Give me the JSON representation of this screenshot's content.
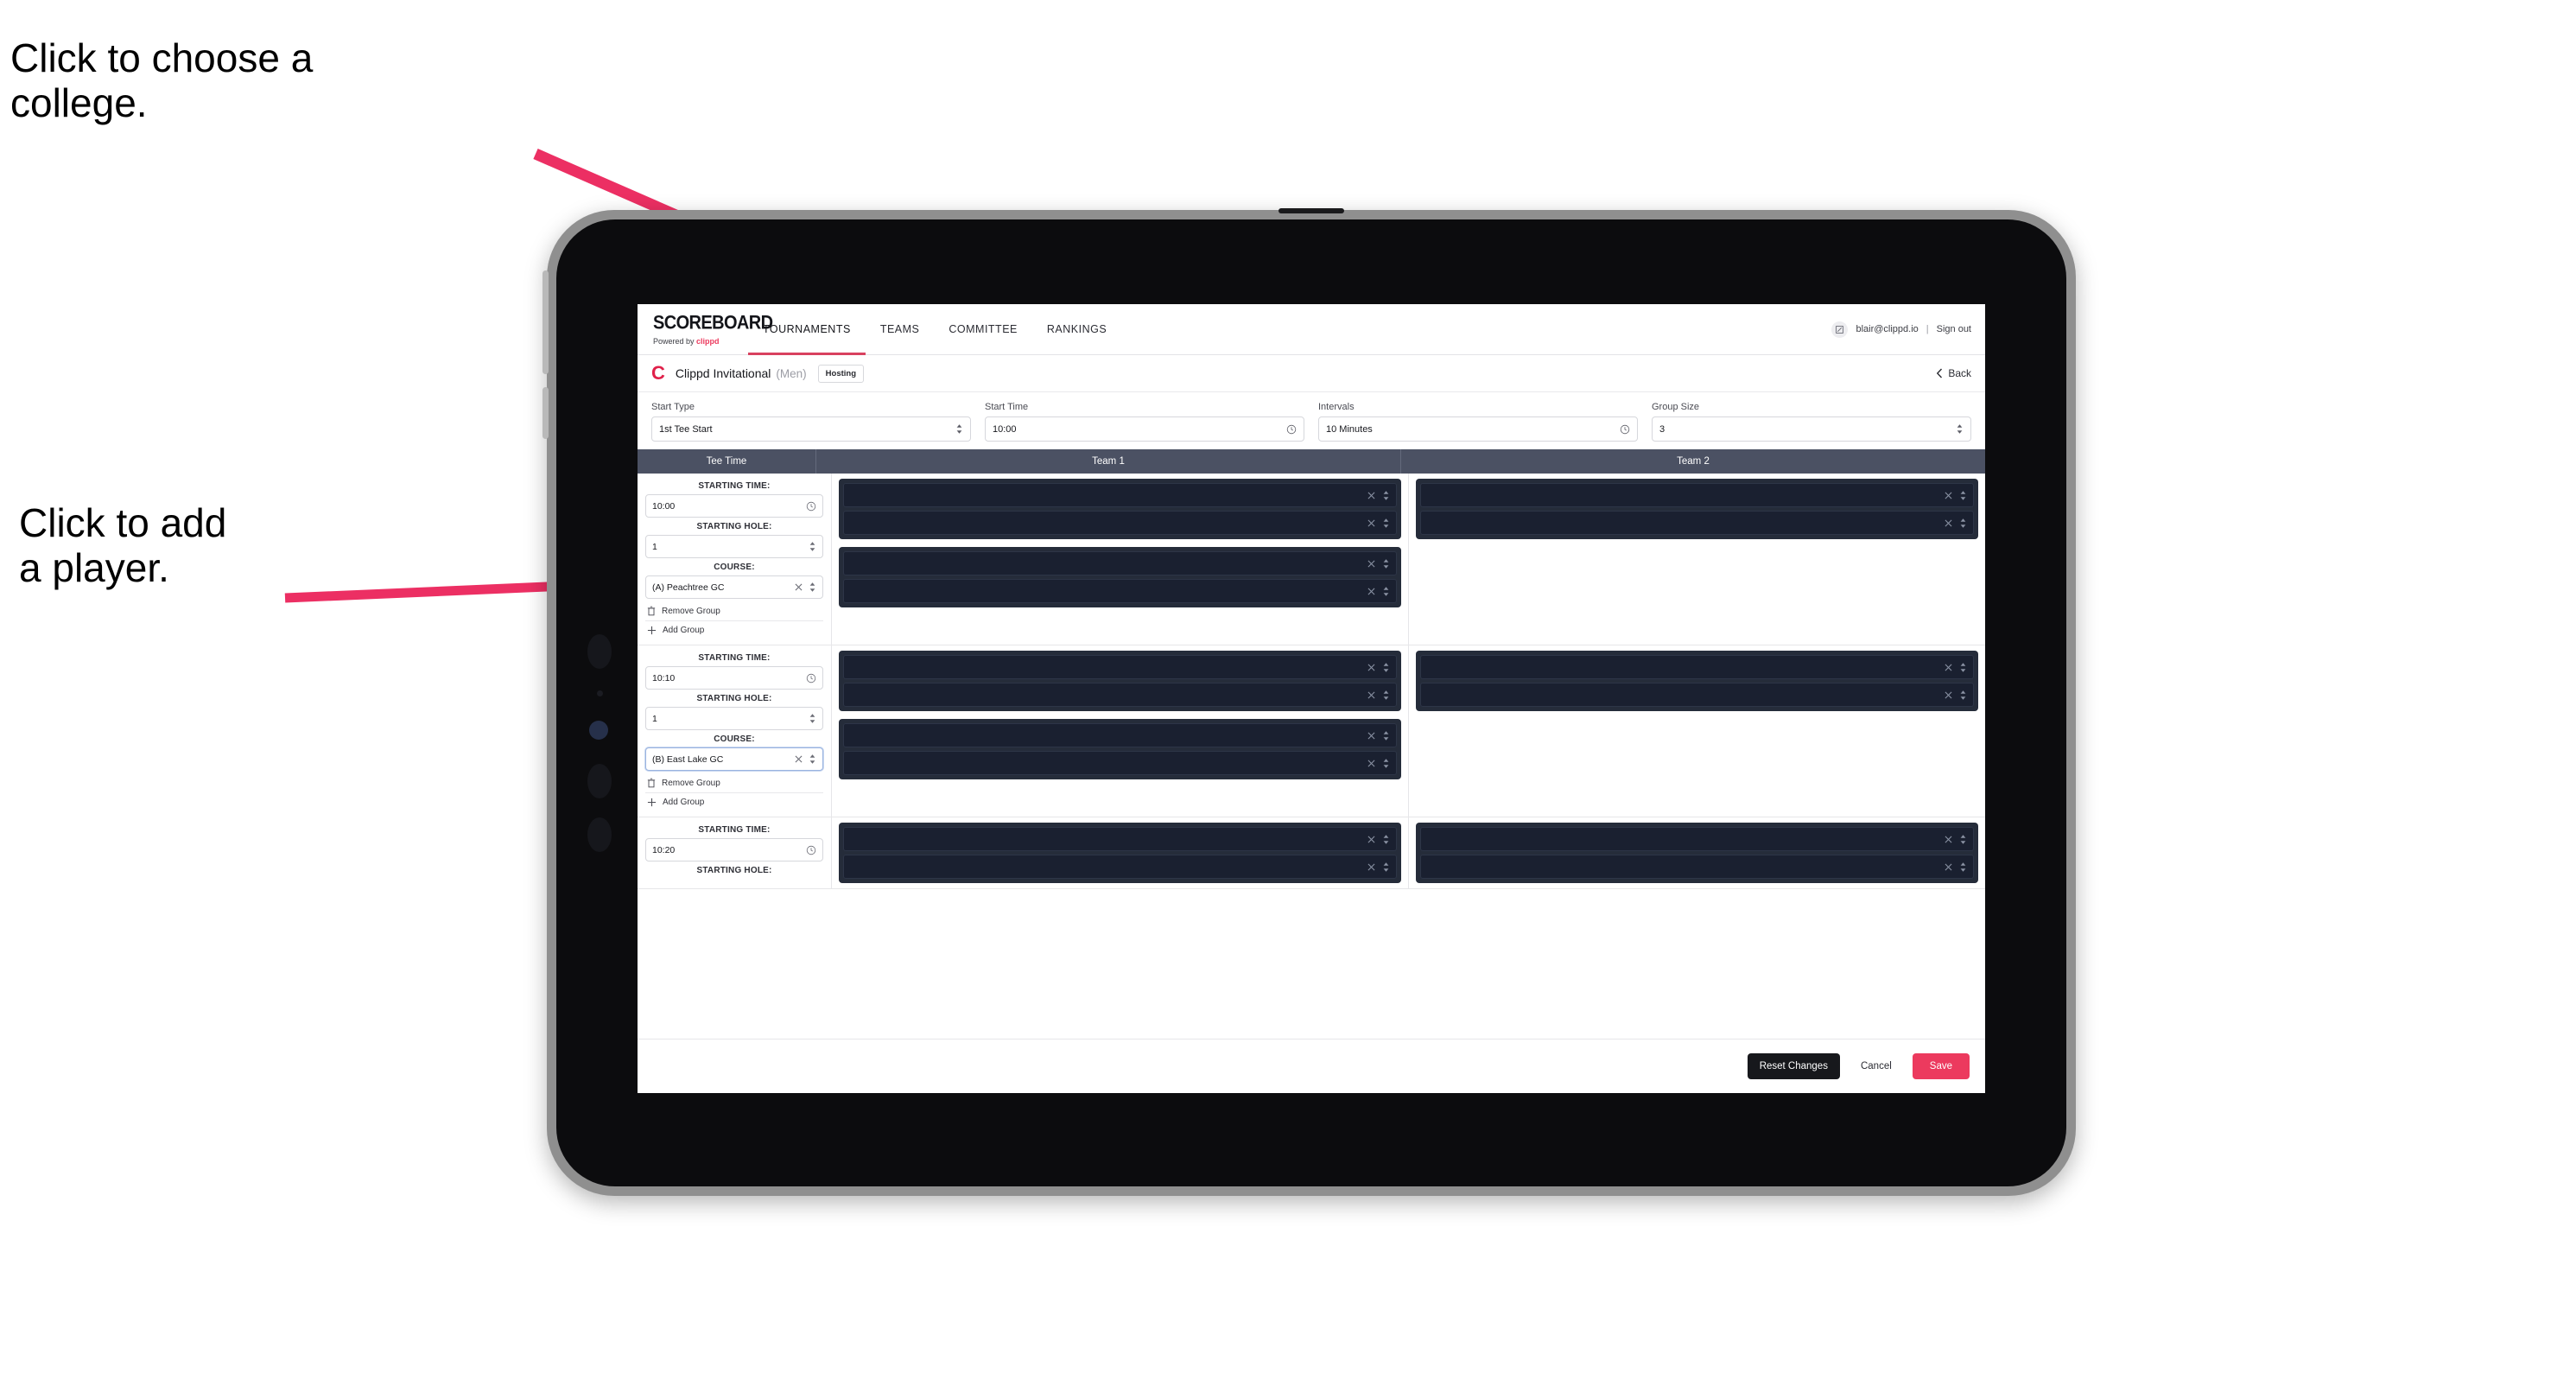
{
  "annotations": [
    {
      "id": "college",
      "text": "Click to choose a\ncollege."
    },
    {
      "id": "player",
      "text": "Click to add\na player."
    }
  ],
  "colors": {
    "accent_pink": "#ec3a5e",
    "nav_active_underline": "#d8415f",
    "table_header_bg": "#4b5163",
    "group_box_bg": "#252c3a",
    "player_row_bg": "#1a2030",
    "arrow": "#ec2f63"
  },
  "appbar": {
    "brand_name": "SCOREBOARD",
    "brand_sub_prefix": "Powered by ",
    "brand_sub_strong": "clippd",
    "nav": [
      {
        "label": "TOURNAMENTS",
        "active": true
      },
      {
        "label": "TEAMS",
        "active": false
      },
      {
        "label": "COMMITTEE",
        "active": false
      },
      {
        "label": "RANKINGS",
        "active": false
      }
    ],
    "avatar_icon": "user-avatar-icon",
    "user_email": "blair@clippd.io",
    "separator": "|",
    "sign_out": "Sign out"
  },
  "tournament_bar": {
    "logo_letter": "C",
    "name": "Clippd Invitational",
    "gender": "(Men)",
    "hosting_badge": "Hosting",
    "back_label": "Back",
    "back_icon": "chevron-left-icon"
  },
  "filters": [
    {
      "label": "Start Type",
      "value": "1st Tee Start",
      "icon": "stepper-icon"
    },
    {
      "label": "Start Time",
      "value": "10:00",
      "icon": "clock-icon"
    },
    {
      "label": "Intervals",
      "value": "10 Minutes",
      "icon": "clock-icon"
    },
    {
      "label": "Group Size",
      "value": "3",
      "icon": "stepper-icon"
    }
  ],
  "table": {
    "headers": {
      "tee": "Tee Time",
      "team1": "Team 1",
      "team2": "Team 2"
    },
    "labels": {
      "starting_time": "STARTING TIME:",
      "starting_hole": "STARTING HOLE:",
      "course": "COURSE:",
      "remove_group": "Remove Group",
      "add_group": "Add Group",
      "remove_icon": "trash-icon",
      "add_icon": "plus-icon",
      "clear_icon": "close-icon",
      "stepper_icon": "stepper-icon",
      "clock_icon": "clock-icon"
    },
    "blocks": [
      {
        "starting_time": "10:00",
        "starting_hole": "1",
        "course": "(A) Peachtree GC",
        "course_focused": false,
        "team1_groups": [
          {
            "players": [
              "",
              ""
            ]
          },
          {
            "players": [
              "",
              ""
            ]
          }
        ],
        "team2_groups": [
          {
            "players": [
              "",
              ""
            ]
          }
        ]
      },
      {
        "starting_time": "10:10",
        "starting_hole": "1",
        "course": "(B) East Lake GC",
        "course_focused": true,
        "team1_groups": [
          {
            "players": [
              "",
              ""
            ]
          },
          {
            "players": [
              "",
              ""
            ]
          }
        ],
        "team2_groups": [
          {
            "players": [
              "",
              ""
            ]
          }
        ]
      },
      {
        "starting_time": "10:20",
        "starting_hole": "",
        "course": "",
        "course_focused": false,
        "team1_groups": [
          {
            "players": [
              "",
              ""
            ]
          }
        ],
        "team2_groups": [
          {
            "players": [
              "",
              ""
            ]
          }
        ]
      }
    ]
  },
  "footer": {
    "reset": "Reset Changes",
    "cancel": "Cancel",
    "save": "Save"
  }
}
